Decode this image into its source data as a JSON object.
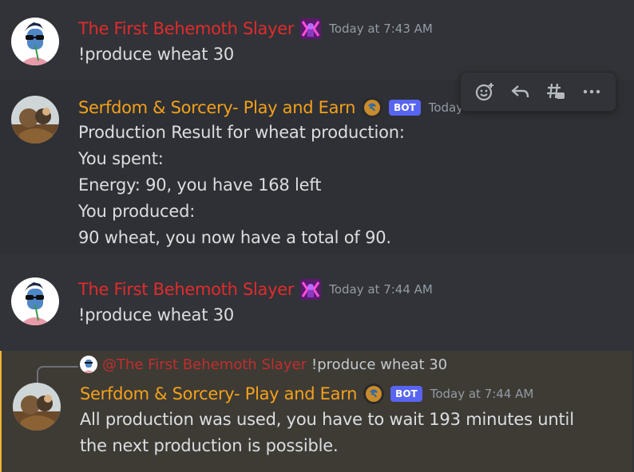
{
  "messages": [
    {
      "username": "The First Behemoth Slayer",
      "timestamp": "Today at 7:43 AM",
      "lines": [
        "!produce wheat 30"
      ]
    },
    {
      "username": "Serfdom & Sorcery- Play and Earn",
      "bot_tag": "BOT",
      "timestamp": "Today at 7:43 AM",
      "lines": [
        "Production Result for wheat production:",
        "You spent:",
        "Energy: 90, you have 168 left",
        "You produced:",
        "90 wheat, you now have a total of 90."
      ]
    },
    {
      "username": "The First Behemoth Slayer",
      "timestamp": "Today at 7:44 AM",
      "lines": [
        "!produce wheat 30"
      ]
    },
    {
      "reply_to_name": "@The First Behemoth Slayer",
      "reply_to_text": "!produce wheat 30",
      "username": "Serfdom & Sorcery- Play and Earn",
      "bot_tag": "BOT",
      "timestamp": "Today at 7:44 AM",
      "lines": [
        "All production was used, you have to wait 193 minutes until",
        "the next production is possible."
      ]
    }
  ],
  "toolbar": {
    "icons": [
      "add-reaction-icon",
      "reply-icon",
      "create-thread-icon",
      "more-icon"
    ]
  },
  "colors": {
    "background": "#313338",
    "user_name": "#e12b2b",
    "bot_name": "#f4a11a",
    "bot_tag": "#5865f2",
    "highlight": "#3e3b35"
  }
}
